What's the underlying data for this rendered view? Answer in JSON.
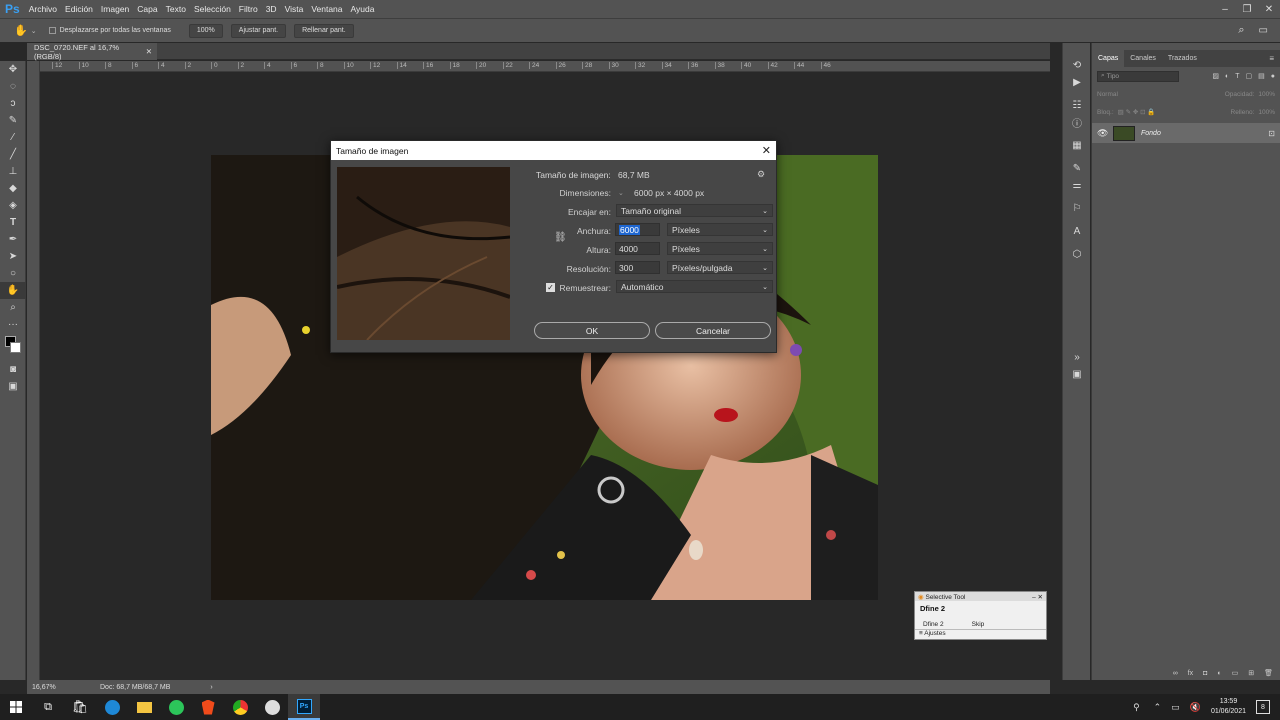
{
  "app": {
    "logo": "Ps"
  },
  "menu": [
    "Archivo",
    "Edición",
    "Imagen",
    "Capa",
    "Texto",
    "Selección",
    "Filtro",
    "3D",
    "Vista",
    "Ventana",
    "Ayuda"
  ],
  "options": {
    "scroll_all_label": "Desplazarse por todas las ventanas",
    "zoom_btn": "100%",
    "fit_btn": "Ajustar pant.",
    "fill_btn": "Rellenar pant."
  },
  "document": {
    "tab_title": "DSC_0720.NEF al 16,7% (RGB/8)"
  },
  "ruler": {
    "top_ticks": [
      "12",
      "10",
      "8",
      "6",
      "4",
      "2",
      "0",
      "2",
      "4",
      "6",
      "8",
      "10",
      "12",
      "14",
      "16",
      "18",
      "20",
      "22",
      "24",
      "26",
      "28",
      "30",
      "32",
      "34",
      "36",
      "38",
      "40",
      "42",
      "44",
      "46"
    ]
  },
  "dialog": {
    "title": "Tamaño de imagen",
    "image_size_label": "Tamaño de imagen:",
    "image_size_value": "68,7 MB",
    "dimensions_label": "Dimensiones:",
    "dimensions_value": "6000 px × 4000 px",
    "fit_label": "Encajar en:",
    "fit_value": "Tamaño original",
    "width_label": "Anchura:",
    "width_value": "6000",
    "width_unit": "Píxeles",
    "height_label": "Altura:",
    "height_value": "4000",
    "height_unit": "Píxeles",
    "resolution_label": "Resolución:",
    "resolution_value": "300",
    "resolution_unit": "Píxeles/pulgada",
    "resample_label": "Remuestrear:",
    "resample_value": "Automático",
    "ok": "OK",
    "cancel": "Cancelar"
  },
  "layers_panel": {
    "tabs": [
      "Capas",
      "Canales",
      "Trazados"
    ],
    "search_placeholder": "Tipo",
    "blend_mode": "Normal",
    "opacity_label": "Opacidad:",
    "opacity_value": "100%",
    "lock_label": "Bloq.:",
    "fill_label": "Relleno:",
    "fill_value": "100%",
    "layer_name": "Fondo"
  },
  "selective_tool": {
    "title": "Selective Tool",
    "item": "Dfine 2",
    "row_left": "Dfine 2",
    "row_right": "Skip",
    "footer": "Ajustes"
  },
  "status": {
    "zoom": "16,67%",
    "doc": "Doc: 68,7 MB/68,7 MB"
  },
  "taskbar": {
    "time": "13:59",
    "date": "01/06/2021",
    "notif_count": "8"
  }
}
